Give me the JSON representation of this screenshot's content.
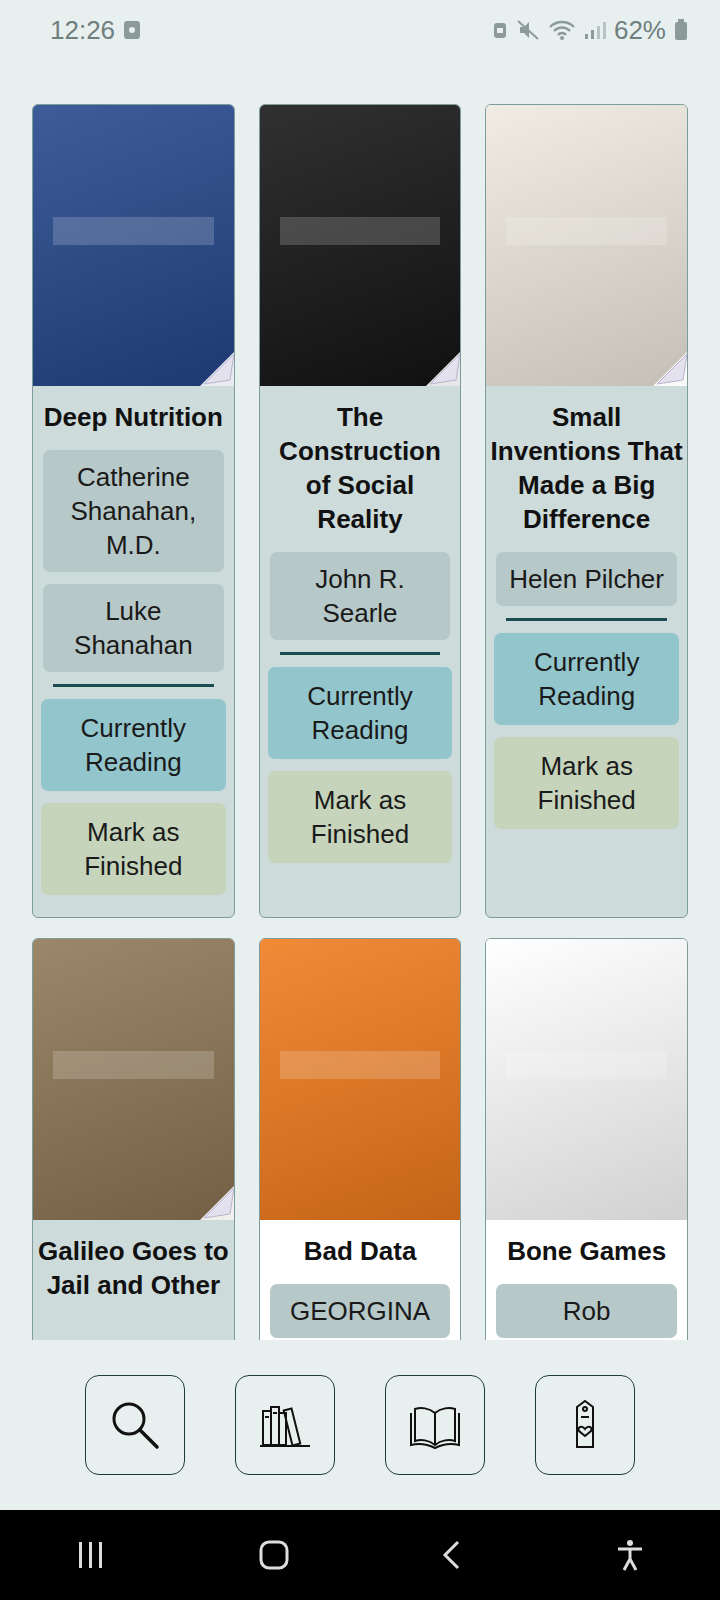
{
  "status_bar": {
    "time": "12:26",
    "battery": "62%"
  },
  "books": [
    {
      "title": "Deep Nutrition",
      "authors": [
        "Catherine Shanahan, M.D.",
        "Luke Shanahan"
      ],
      "actions": [
        {
          "label": "Currently Reading",
          "kind": "reading"
        },
        {
          "label": "Mark as Finished",
          "kind": "finish"
        }
      ],
      "marked": true,
      "color": "#23468a"
    },
    {
      "title": "The Construction of Social Reality",
      "authors": [
        "John R. Searle"
      ],
      "actions": [
        {
          "label": "Currently Reading",
          "kind": "reading"
        },
        {
          "label": "Mark as Finished",
          "kind": "finish"
        }
      ],
      "marked": true,
      "color": "#141414"
    },
    {
      "title": "Small Inventions That Made a Big Difference",
      "authors": [
        "Helen Pilcher"
      ],
      "actions": [
        {
          "label": "Currently Reading",
          "kind": "reading"
        },
        {
          "label": "Mark as Finished",
          "kind": "finish"
        }
      ],
      "marked": true,
      "color": "#efeadf"
    },
    {
      "title": "Galileo Goes to Jail and Other",
      "authors": [],
      "actions": [],
      "marked": true,
      "color": "#8d7654"
    },
    {
      "title": "Bad Data",
      "authors": [
        "GEORGINA"
      ],
      "actions": [],
      "marked": false,
      "color": "#f07a1c"
    },
    {
      "title": "Bone Games",
      "authors": [
        "Rob"
      ],
      "actions": [],
      "marked": false,
      "color": "#ffffff"
    }
  ]
}
